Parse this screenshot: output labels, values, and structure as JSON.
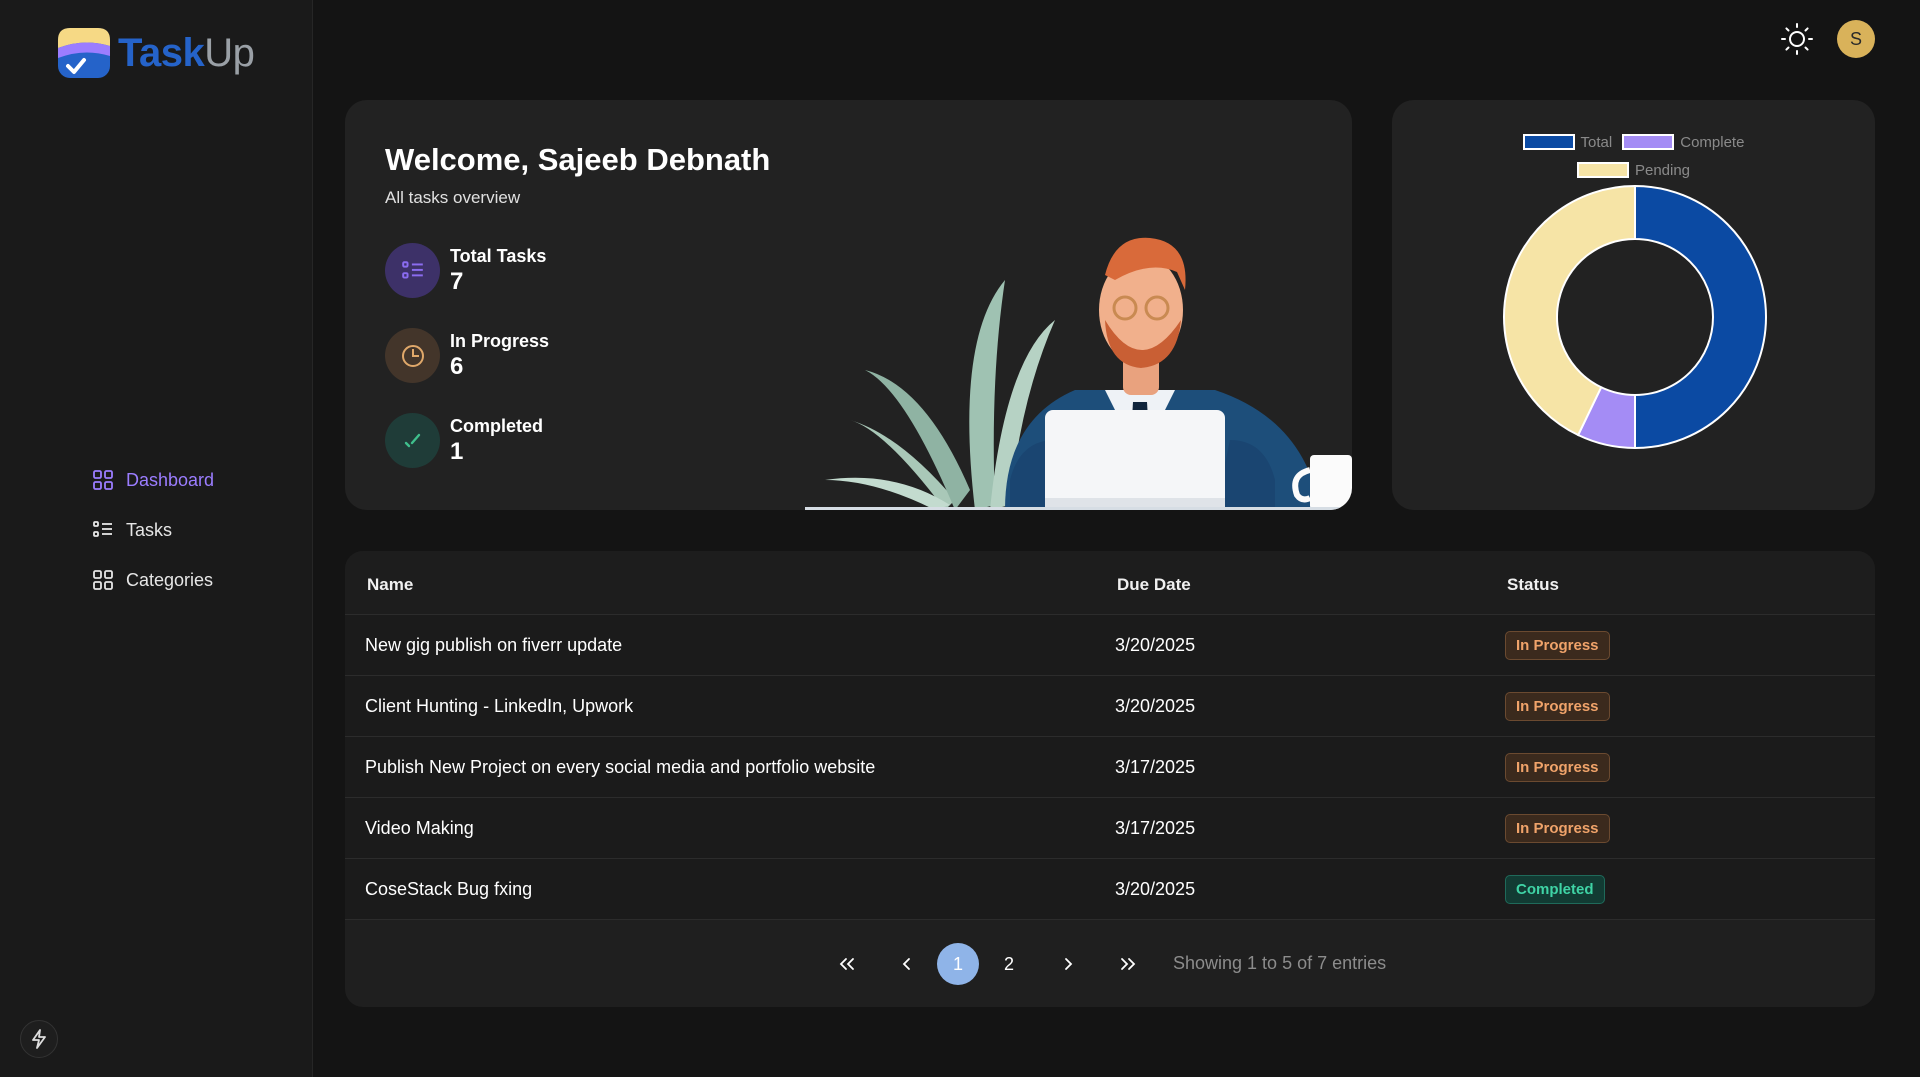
{
  "brand": {
    "name_part1": "Task",
    "name_part2": "Up"
  },
  "sidebar": {
    "items": [
      {
        "label": "Dashboard",
        "icon": "grid-icon",
        "active": true
      },
      {
        "label": "Tasks",
        "icon": "list-icon",
        "active": false
      },
      {
        "label": "Categories",
        "icon": "categories-icon",
        "active": false
      }
    ]
  },
  "header": {
    "avatar_initial": "S",
    "theme_icon": "sun-icon"
  },
  "welcome": {
    "title": "Welcome, Sajeeb Debnath",
    "subtitle": "All tasks overview",
    "stats": [
      {
        "label": "Total Tasks",
        "value": "7",
        "icon": "list-icon",
        "color": "#8b6cf0"
      },
      {
        "label": "In Progress",
        "value": "6",
        "icon": "clock-icon",
        "color": "#e0a86a"
      },
      {
        "label": "Completed",
        "value": "1",
        "icon": "check-icon",
        "color": "#3fbf8c"
      }
    ]
  },
  "chart_data": {
    "type": "pie",
    "donut": true,
    "legend": [
      {
        "name": "Total",
        "color": "#0b4aa3"
      },
      {
        "name": "Complete",
        "color": "#a48cf5"
      },
      {
        "name": "Pending",
        "color": "#f6e4a6"
      }
    ],
    "categories": [
      "Total",
      "Complete",
      "Pending"
    ],
    "values": [
      7,
      1,
      6
    ],
    "colors": [
      "#0b4aa3",
      "#a48cf5",
      "#f6e4a6"
    ]
  },
  "table": {
    "headers": {
      "name": "Name",
      "due": "Due Date",
      "status": "Status"
    },
    "rows": [
      {
        "name": "New gig publish on fiverr update",
        "due": "3/20/2025",
        "status": "In Progress"
      },
      {
        "name": "Client Hunting - LinkedIn, Upwork",
        "due": "3/20/2025",
        "status": "In Progress"
      },
      {
        "name": "Publish New Project on every social media and portfolio website",
        "due": "3/17/2025",
        "status": "In Progress"
      },
      {
        "name": "Video Making",
        "due": "3/17/2025",
        "status": "In Progress"
      },
      {
        "name": "CoseStack Bug fxing",
        "due": "3/20/2025",
        "status": "Completed"
      }
    ],
    "pagination": {
      "first": "«",
      "prev": "‹",
      "pages": [
        "1",
        "2"
      ],
      "current": "1",
      "next": "›",
      "last": "»",
      "summary": "Showing 1 to 5 of 7 entries"
    }
  }
}
